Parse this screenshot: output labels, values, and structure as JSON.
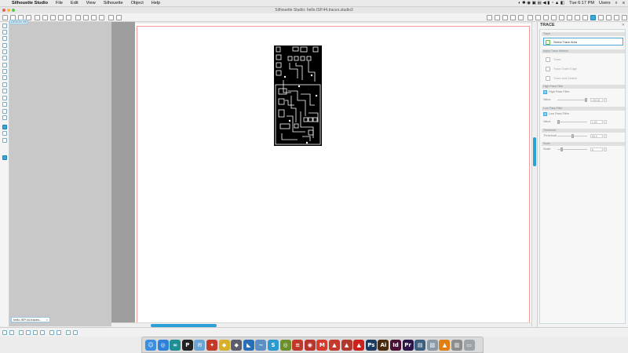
{
  "menubar": {
    "apple_glyph": "",
    "app_name": "Silhouette Studio",
    "items": [
      "File",
      "Edit",
      "View",
      "Silhouette",
      "Object",
      "Help"
    ],
    "clock": "Tue 6:17 PM",
    "user": "Users"
  },
  "window": {
    "title": "Silhouette Studio: hello.ISP.44.traces.studio3"
  },
  "design_tab": {
    "label": "DESIGN VIEW"
  },
  "document_tab": {
    "label": "hello.ISP.44.traces...",
    "close_glyph": "×"
  },
  "trace_panel": {
    "title": "TRACE",
    "close_glyph": "✕",
    "sections": {
      "trace": "Trace",
      "apply_method": "Apply Trace Method",
      "high_pass": "High Pass Filter",
      "low_pass": "Low Pass Filter",
      "threshold": "Threshold",
      "scale": "Scale"
    },
    "select_area_button": "Select Trace Area",
    "methods": [
      "Trace",
      "Trace Outer Edge",
      "Trace and Detach"
    ],
    "high_pass": {
      "label": "High Pass Filter",
      "value_label": "Value",
      "value": "100.00"
    },
    "low_pass": {
      "label": "Low Pass Filter",
      "value_label": "Value",
      "value": "1.00"
    },
    "threshold": {
      "label": "Threshold",
      "value": "50.0"
    },
    "scale": {
      "label": "Scale",
      "value": "6"
    }
  },
  "colors": {
    "accent": "#2aa0d6",
    "cut_line": "#f19b9b",
    "pcb": "#000000"
  },
  "dock": {
    "apps": [
      {
        "name": "finder",
        "glyph": "☺",
        "color": "#3b8fe0"
      },
      {
        "name": "safari",
        "glyph": "◎",
        "color": "#2f80d8"
      },
      {
        "name": "arduino",
        "glyph": "∞",
        "color": "#1f8e95"
      },
      {
        "name": "pdf",
        "glyph": "P",
        "color": "#222222"
      },
      {
        "name": "mail",
        "glyph": "✉",
        "color": "#6aa5d8"
      },
      {
        "name": "app-red",
        "glyph": "✦",
        "color": "#c33a2b"
      },
      {
        "name": "app-yellow",
        "glyph": "◆",
        "color": "#d7b12a"
      },
      {
        "name": "app-gray",
        "glyph": "◆",
        "color": "#5e5e6a"
      },
      {
        "name": "app-blue",
        "glyph": "◣",
        "color": "#276fb8"
      },
      {
        "name": "app-wave",
        "glyph": "~",
        "color": "#5b8fc6"
      },
      {
        "name": "silhouette",
        "glyph": "S",
        "color": "#2a9ad3"
      },
      {
        "name": "app-green",
        "glyph": "◎",
        "color": "#6b8f2a"
      },
      {
        "name": "app-stripes",
        "glyph": "≡",
        "color": "#c0392b"
      },
      {
        "name": "app-ring",
        "glyph": "◉",
        "color": "#b8342c"
      },
      {
        "name": "mm",
        "glyph": "M",
        "color": "#d63b2b"
      },
      {
        "name": "sketch",
        "glyph": "▲",
        "color": "#c43b2e"
      },
      {
        "name": "sketch2",
        "glyph": "▲",
        "color": "#b03a2e"
      },
      {
        "name": "acrobat",
        "glyph": "▲",
        "color": "#c8231c"
      },
      {
        "name": "photoshop",
        "glyph": "Ps",
        "color": "#1b3b63"
      },
      {
        "name": "illustrator",
        "glyph": "Ai",
        "color": "#4a2a0c"
      },
      {
        "name": "indesign",
        "glyph": "Id",
        "color": "#4a1035"
      },
      {
        "name": "premiere",
        "glyph": "Pr",
        "color": "#2b1446"
      },
      {
        "name": "app-doc",
        "glyph": "▤",
        "color": "#3d5f82"
      },
      {
        "name": "preview",
        "glyph": "▧",
        "color": "#8c9aa8"
      },
      {
        "name": "vlc",
        "glyph": "▲",
        "color": "#e07f12"
      },
      {
        "name": "docs",
        "glyph": "▥",
        "color": "#8d8d8d"
      },
      {
        "name": "trash",
        "glyph": "▭",
        "color": "#9ea3a8"
      }
    ]
  }
}
